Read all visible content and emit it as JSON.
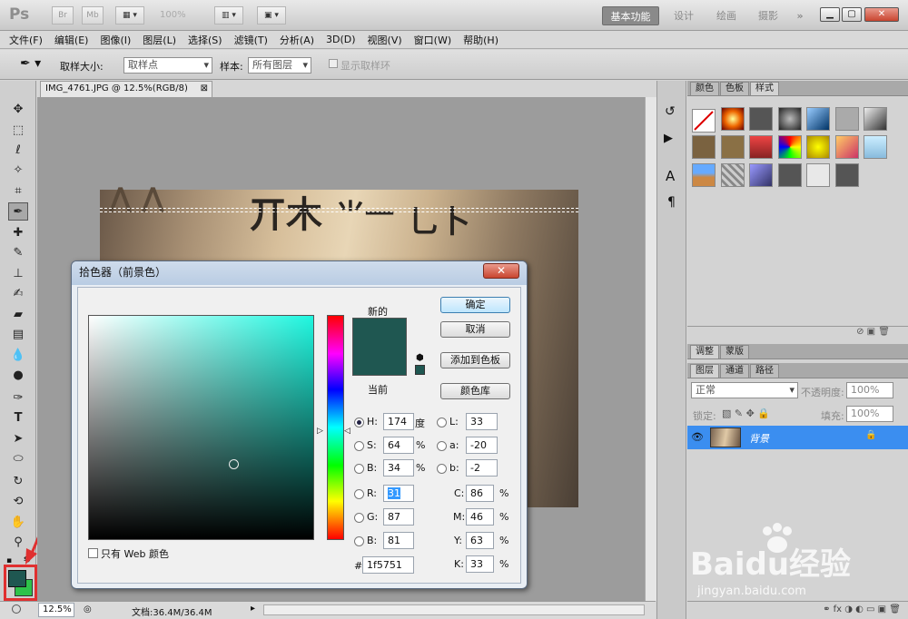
{
  "app": {
    "logo": "Ps",
    "br": "Br",
    "mb": "Mb",
    "zoom": "100%"
  },
  "workspaces": [
    "基本功能",
    "设计",
    "绘画",
    "摄影"
  ],
  "menu": [
    "文件(F)",
    "编辑(E)",
    "图像(I)",
    "图层(L)",
    "选择(S)",
    "滤镜(T)",
    "分析(A)",
    "3D(D)",
    "视图(V)",
    "窗口(W)",
    "帮助(H)"
  ],
  "options": {
    "sample_size_label": "取样大小:",
    "sample_size_value": "取样点",
    "sample_label": "样本:",
    "sample_value": "所有图层",
    "show_ring": "显示取样环"
  },
  "document": {
    "tab": "IMG_4761.JPG @ 12.5%(RGB/8)",
    "close": "⊠"
  },
  "status": {
    "zoom": "12.5%",
    "doc": "文档:36.4M/36.4M"
  },
  "panels": {
    "top_tabs": [
      "颜色",
      "色板",
      "样式"
    ],
    "mid_tabs": [
      "调整",
      "蒙版"
    ],
    "layer_tabs": [
      "图层",
      "通道",
      "路径"
    ],
    "blend_mode": "正常",
    "opacity_label": "不透明度:",
    "opacity_value": "100%",
    "lock_label": "锁定:",
    "fill_label": "填充:",
    "fill_value": "100%",
    "layer_name": "背景"
  },
  "dialog": {
    "title": "拾色器（前景色）",
    "close": "✕",
    "new_label": "新的",
    "current_label": "当前",
    "ok": "确定",
    "cancel": "取消",
    "add_swatch": "添加到色板",
    "color_libraries": "颜色库",
    "web_only": "只有 Web 颜色",
    "new_color": "#1f5751",
    "current_color": "#1f5751",
    "hsb": {
      "H": "174",
      "S": "64",
      "B": "34",
      "H_unit": "度",
      "S_unit": "%",
      "B_unit": "%"
    },
    "rgb": {
      "R": "31",
      "G": "87",
      "B": "81"
    },
    "lab": {
      "L": "33",
      "a": "-20",
      "b": "-2"
    },
    "cmyk": {
      "C": "86",
      "M": "46",
      "Y": "63",
      "K": "33",
      "unit": "%"
    },
    "hex_label": "#",
    "hex": "1f5751",
    "labels": {
      "H": "H:",
      "S": "S:",
      "Bb": "B:",
      "R": "R:",
      "G": "G:",
      "Bl": "B:",
      "L": "L:",
      "a": "a:",
      "b": "b:",
      "C": "C:",
      "M": "M:",
      "Y": "Y:",
      "K": "K:"
    }
  },
  "colors": {
    "foreground": "#1f5751",
    "background": "#2ec24a",
    "highlight": "#e03030"
  },
  "watermark": {
    "brand": "Baidu经验",
    "url": "jingyan.baidu.com"
  }
}
